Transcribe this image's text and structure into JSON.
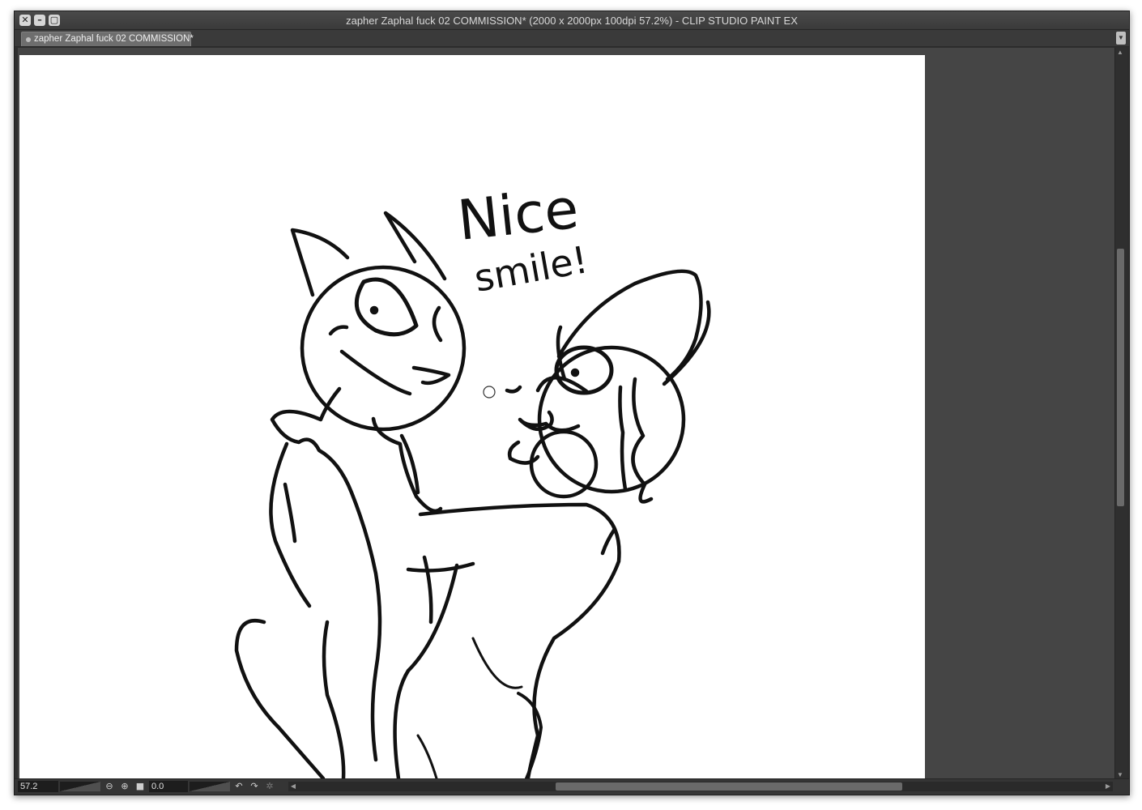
{
  "window": {
    "title": "zapher Zaphal fuck 02 COMMISSION* (2000 x 2000px 100dpi 57.2%)  - CLIP STUDIO PAINT EX",
    "controls": {
      "close": "close-icon",
      "minimize": "minimize-icon",
      "maximize": "maximize-icon"
    }
  },
  "tabs": [
    {
      "label": "zapher Zaphal fuck 02 COMMISSION*",
      "active": true
    }
  ],
  "canvas": {
    "speech_line1": "Nice",
    "speech_line2": "smile!"
  },
  "statusbar": {
    "zoom_value": "57.2",
    "angle_value": "0.0",
    "icons": [
      "zoom-out-icon",
      "zoom-in-icon",
      "fit-window-icon",
      "rotate-left-icon",
      "rotate-right-icon",
      "reset-rotation-icon"
    ]
  },
  "colors": {
    "frame": "#2e2e2e",
    "workspace": "#454545",
    "canvas": "#ffffff",
    "ink": "#111111"
  }
}
